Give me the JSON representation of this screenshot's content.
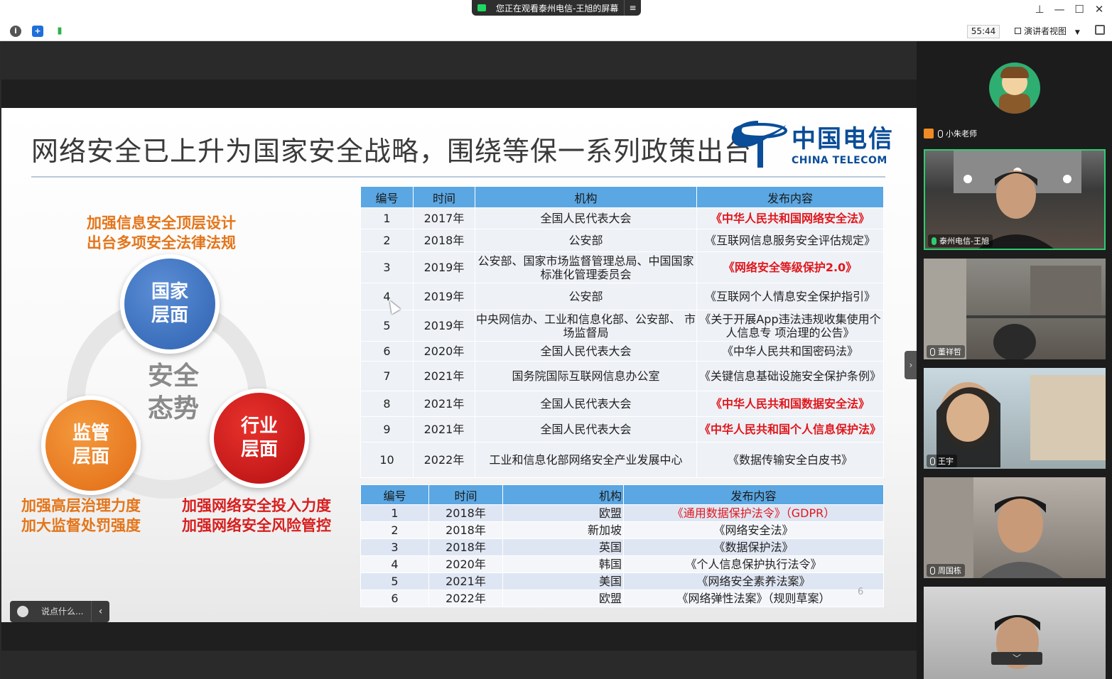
{
  "top_bar": {
    "share_banner": "您正在观看泰州电信-王旭的屏幕",
    "share_menu": "≡",
    "timer": "55:44",
    "view_mode": "演讲者视图"
  },
  "slide": {
    "title": "网络安全已上升为国家安全战略，围绕等保一系列政策出台",
    "logo_cn": "中国电信",
    "logo_en": "CHINA TELECOM",
    "top_caption_1": "加强信息安全顶层设计",
    "top_caption_2": "出台多项安全法律法规",
    "center_label_1": "安全",
    "center_label_2": "态势",
    "national_1": "国家",
    "national_2": "层面",
    "supervision_1": "监管",
    "supervision_2": "层面",
    "industry_1": "行业",
    "industry_2": "层面",
    "left_caption_1": "加强高层治理力度",
    "left_caption_2": "加大监督处罚强度",
    "right_caption_1": "加强网络安全投入力度",
    "right_caption_2": "加强网络安全风险管控",
    "page_number": "6"
  },
  "table1": {
    "headers": [
      "编号",
      "时间",
      "机构",
      "发布内容"
    ],
    "rows": [
      [
        "1",
        "2017年",
        "全国人民代表大会",
        "《中华人民共和国网络安全法》"
      ],
      [
        "2",
        "2018年",
        "公安部",
        "《互联网信息服务安全评估规定》"
      ],
      [
        "3",
        "2019年",
        "公安部、国家市场监督管理总局、中国国家标准化管理委员会",
        "《网络安全等级保护2.0》"
      ],
      [
        "4",
        "2019年",
        "公安部",
        "《互联网个人情息安全保护指引》"
      ],
      [
        "5",
        "2019年",
        "中央网信办、工业和信息化部、公安部、 市场监督局",
        "《关于开展App违法违规收集使用个人信息专 项治理的公告》"
      ],
      [
        "6",
        "2020年",
        "全国人民代表大会",
        "《中华人民共和国密码法》"
      ],
      [
        "7",
        "2021年",
        "国务院国际互联网信息办公室",
        "《关键信息基础设施安全保护条例》"
      ],
      [
        "8",
        "2021年",
        "全国人民代表大会",
        "《中华人民共和国数据安全法》"
      ],
      [
        "9",
        "2021年",
        "全国人民代表大会",
        "《中华人民共和国个人信息保护法》"
      ],
      [
        "10",
        "2022年",
        "工业和信息化部网络安全产业发展中心",
        "《数据传输安全白皮书》"
      ]
    ]
  },
  "table2": {
    "headers": [
      "编号",
      "时间",
      "机构",
      "发布内容"
    ],
    "rows": [
      [
        "1",
        "2018年",
        "欧盟",
        "《通用数据保护法令》（GDPR）"
      ],
      [
        "2",
        "2018年",
        "新加坡",
        "《网络安全法》"
      ],
      [
        "3",
        "2018年",
        "英国",
        "《数据保护法》"
      ],
      [
        "4",
        "2020年",
        "韩国",
        "《个人信息保护执行法令》"
      ],
      [
        "5",
        "2021年",
        "美国",
        "《网络安全素养法案》"
      ],
      [
        "6",
        "2022年",
        "欧盟",
        "《网络弹性法案》（规则草案）"
      ]
    ]
  },
  "chat": {
    "placeholder": "说点什么..."
  },
  "participants": [
    {
      "name": "小朱老师"
    },
    {
      "name": "泰州电信-王旭"
    },
    {
      "name": "董祥哲"
    },
    {
      "name": "王宇"
    },
    {
      "name": "周国栋"
    }
  ],
  "colors": {
    "accent_green": "#2ecc71",
    "table_header": "#5aa7e3",
    "highlight_red": "#e0171c",
    "caption_orange": "#e4751a"
  }
}
